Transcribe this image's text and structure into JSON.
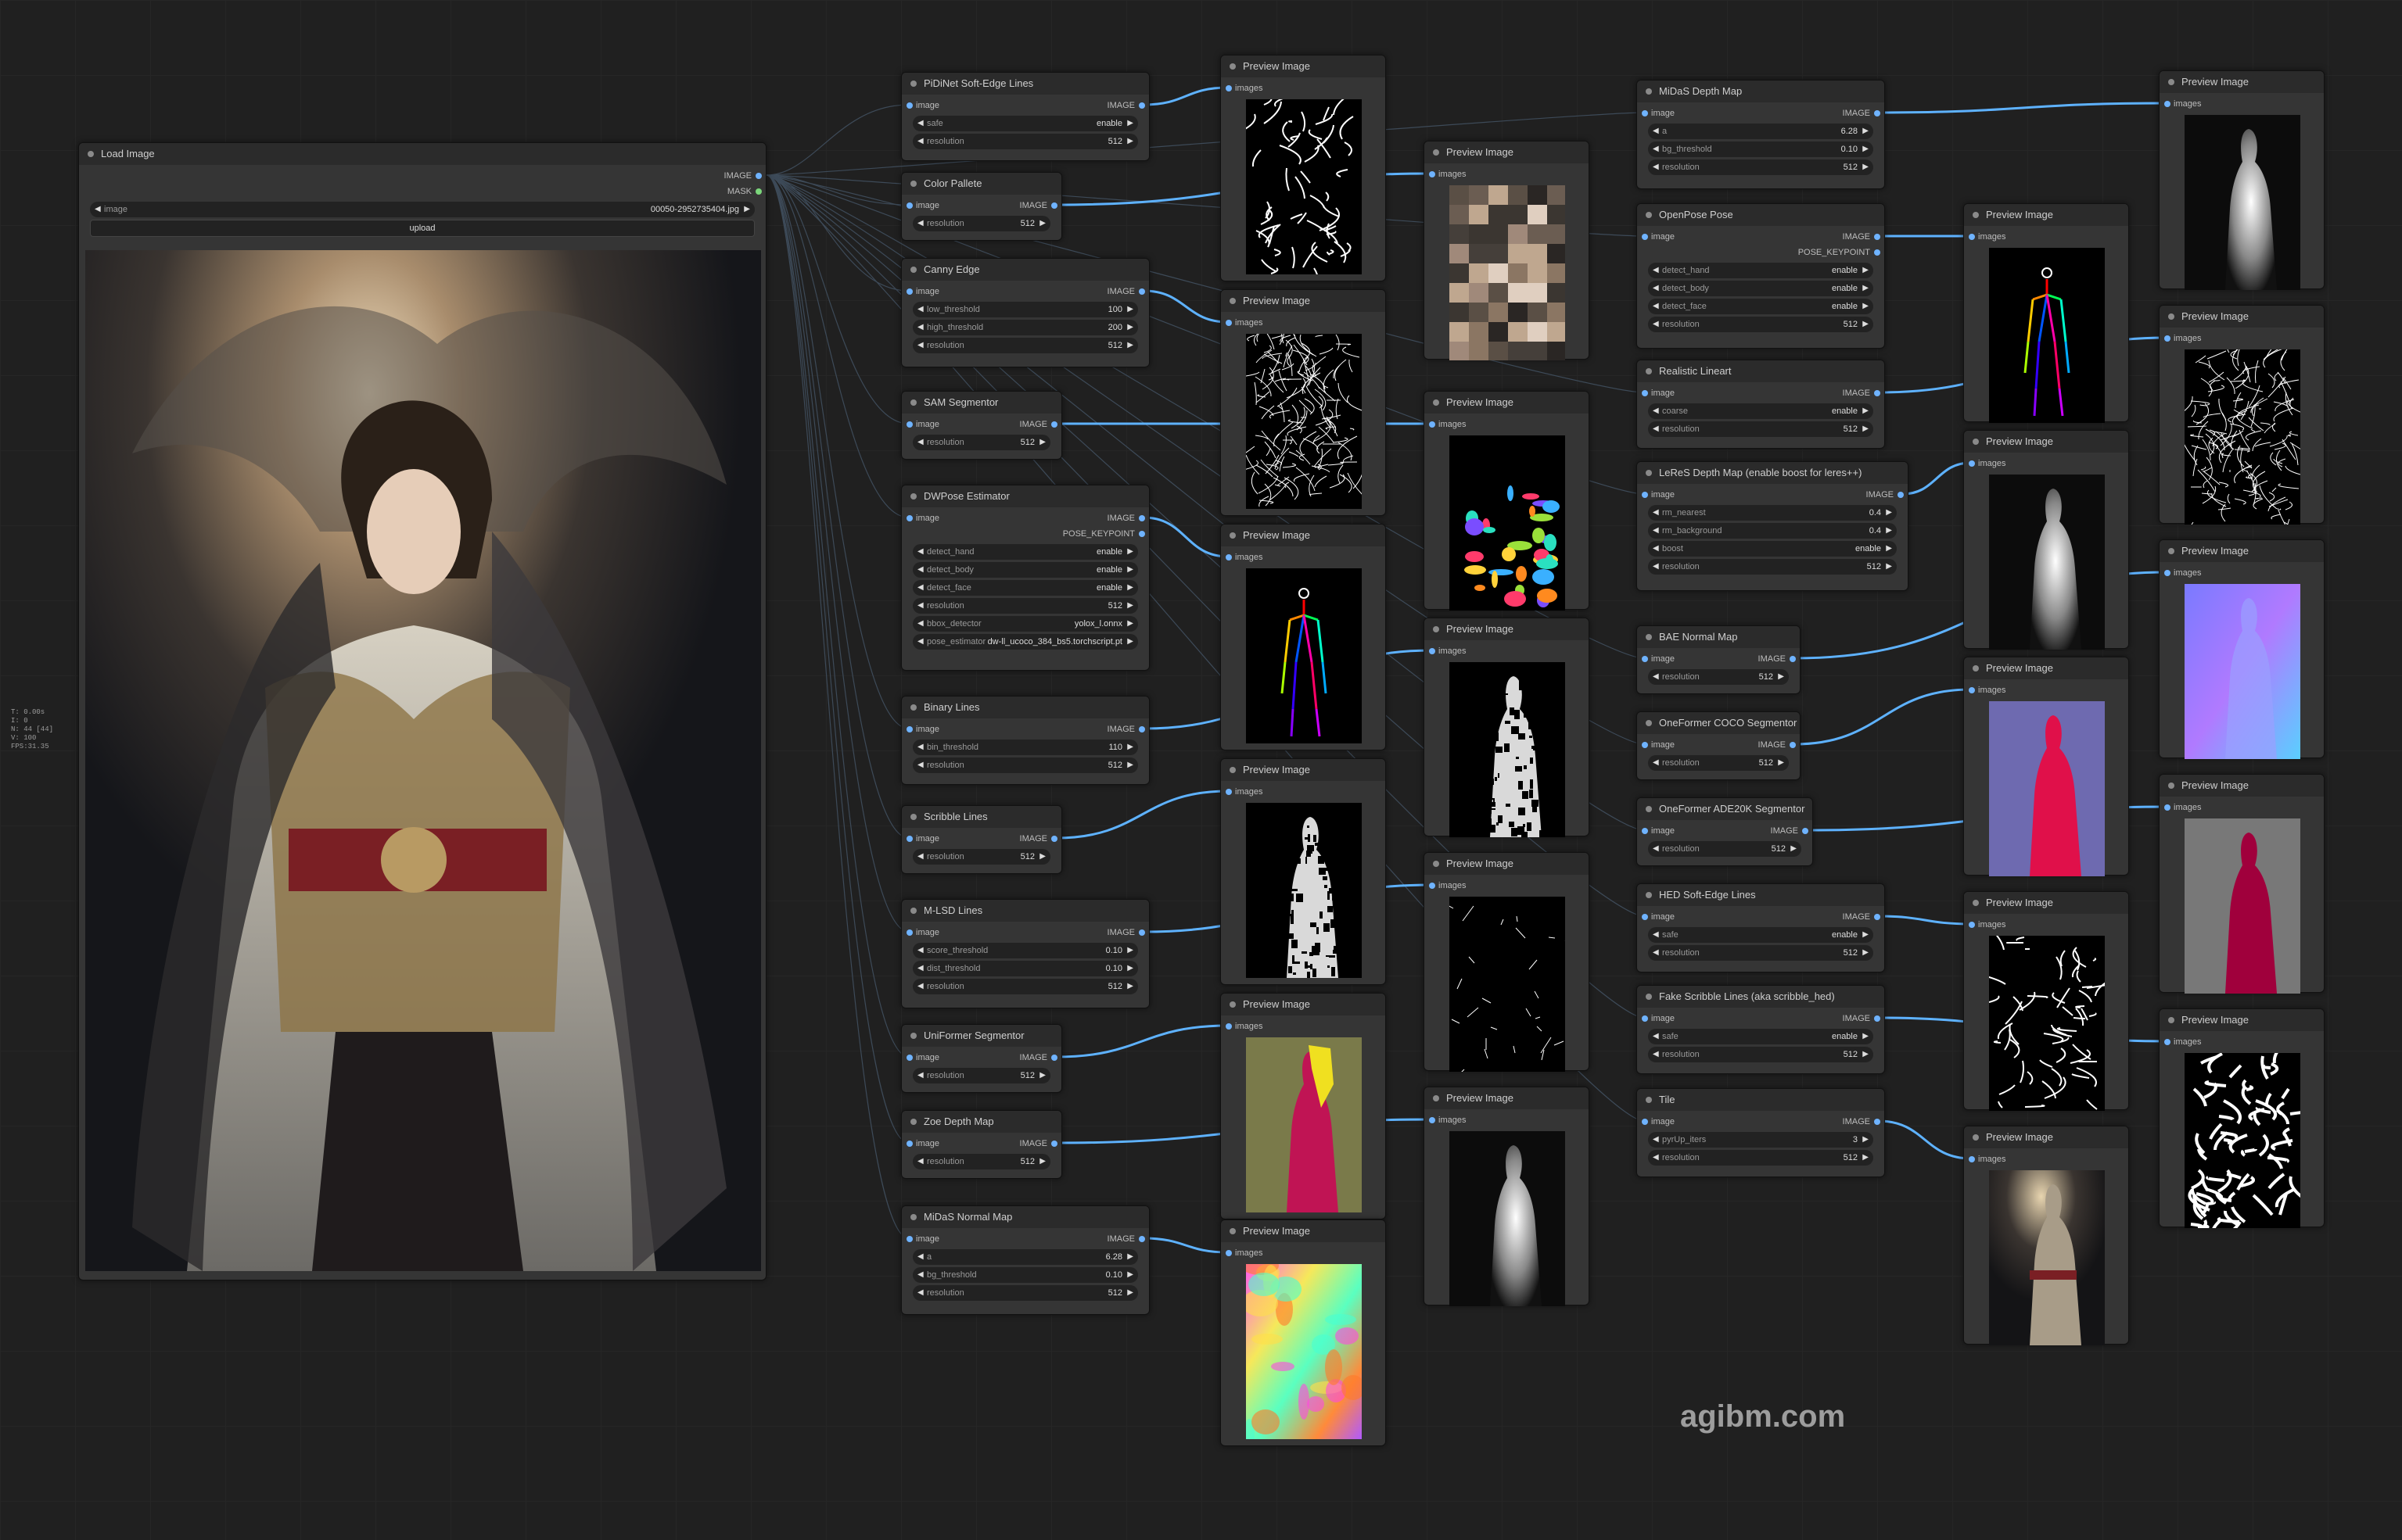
{
  "canvas_stats": [
    "T: 0.00s",
    "I: 0",
    "N: 44 [44]",
    "V: 100",
    "FPS:31.35"
  ],
  "watermark": "agibm.com",
  "load_image": {
    "title": "Load Image",
    "outputs": [
      "IMAGE",
      "MASK"
    ],
    "image_label": "image",
    "image_value": "00050-2952735404.jpg",
    "upload_label": "upload"
  },
  "preview_title": "Preview Image",
  "preview_input": "images",
  "colors": {
    "background": "#202020",
    "node": "#353535",
    "title_bar": "#2b2b2b",
    "link": "#5eb2ff",
    "slot_image": "#6fb3ff",
    "slot_mask": "#7bd67b"
  },
  "nodes": [
    {
      "title": "PiDiNet Soft-Edge Lines",
      "input": "image",
      "outputs": [
        "IMAGE"
      ],
      "widgets": [
        {
          "l": "safe",
          "v": "enable"
        },
        {
          "l": "resolution",
          "v": "512"
        }
      ]
    },
    {
      "title": "Color Pallete",
      "input": "image",
      "outputs": [
        "IMAGE"
      ],
      "widgets": [
        {
          "l": "resolution",
          "v": "512"
        }
      ]
    },
    {
      "title": "Canny Edge",
      "input": "image",
      "outputs": [
        "IMAGE"
      ],
      "widgets": [
        {
          "l": "low_threshold",
          "v": "100"
        },
        {
          "l": "high_threshold",
          "v": "200"
        },
        {
          "l": "resolution",
          "v": "512"
        }
      ]
    },
    {
      "title": "SAM Segmentor",
      "input": "image",
      "outputs": [
        "IMAGE"
      ],
      "widgets": [
        {
          "l": "resolution",
          "v": "512"
        }
      ]
    },
    {
      "title": "DWPose Estimator",
      "input": "image",
      "outputs": [
        "IMAGE",
        "POSE_KEYPOINT"
      ],
      "widgets": [
        {
          "l": "detect_hand",
          "v": "enable"
        },
        {
          "l": "detect_body",
          "v": "enable"
        },
        {
          "l": "detect_face",
          "v": "enable"
        },
        {
          "l": "resolution",
          "v": "512"
        },
        {
          "l": "bbox_detector",
          "v": "yolox_l.onnx"
        },
        {
          "l": "pose_estimator",
          "v": "dw-ll_ucoco_384_bs5.torchscript.pt"
        }
      ]
    },
    {
      "title": "Binary Lines",
      "input": "image",
      "outputs": [
        "IMAGE"
      ],
      "widgets": [
        {
          "l": "bin_threshold",
          "v": "110"
        },
        {
          "l": "resolution",
          "v": "512"
        }
      ]
    },
    {
      "title": "Scribble Lines",
      "input": "image",
      "outputs": [
        "IMAGE"
      ],
      "widgets": [
        {
          "l": "resolution",
          "v": "512"
        }
      ]
    },
    {
      "title": "M-LSD Lines",
      "input": "image",
      "outputs": [
        "IMAGE"
      ],
      "widgets": [
        {
          "l": "score_threshold",
          "v": "0.10"
        },
        {
          "l": "dist_threshold",
          "v": "0.10"
        },
        {
          "l": "resolution",
          "v": "512"
        }
      ]
    },
    {
      "title": "UniFormer Segmentor",
      "input": "image",
      "outputs": [
        "IMAGE"
      ],
      "widgets": [
        {
          "l": "resolution",
          "v": "512"
        }
      ]
    },
    {
      "title": "Zoe Depth Map",
      "input": "image",
      "outputs": [
        "IMAGE"
      ],
      "widgets": [
        {
          "l": "resolution",
          "v": "512"
        }
      ]
    },
    {
      "title": "MiDaS Normal Map",
      "input": "image",
      "outputs": [
        "IMAGE"
      ],
      "widgets": [
        {
          "l": "a",
          "v": "6.28"
        },
        {
          "l": "bg_threshold",
          "v": "0.10"
        },
        {
          "l": "resolution",
          "v": "512"
        }
      ]
    },
    {
      "title": "MiDaS Depth Map",
      "input": "image",
      "outputs": [
        "IMAGE"
      ],
      "widgets": [
        {
          "l": "a",
          "v": "6.28"
        },
        {
          "l": "bg_threshold",
          "v": "0.10"
        },
        {
          "l": "resolution",
          "v": "512"
        }
      ]
    },
    {
      "title": "OpenPose Pose",
      "input": "image",
      "outputs": [
        "IMAGE",
        "POSE_KEYPOINT"
      ],
      "widgets": [
        {
          "l": "detect_hand",
          "v": "enable"
        },
        {
          "l": "detect_body",
          "v": "enable"
        },
        {
          "l": "detect_face",
          "v": "enable"
        },
        {
          "l": "resolution",
          "v": "512"
        }
      ]
    },
    {
      "title": "Realistic Lineart",
      "input": "image",
      "outputs": [
        "IMAGE"
      ],
      "widgets": [
        {
          "l": "coarse",
          "v": "enable"
        },
        {
          "l": "resolution",
          "v": "512"
        }
      ]
    },
    {
      "title": "LeReS Depth Map (enable boost for leres++)",
      "input": "image",
      "outputs": [
        "IMAGE"
      ],
      "widgets": [
        {
          "l": "rm_nearest",
          "v": "0.4"
        },
        {
          "l": "rm_background",
          "v": "0.4"
        },
        {
          "l": "boost",
          "v": "enable"
        },
        {
          "l": "resolution",
          "v": "512"
        }
      ]
    },
    {
      "title": "BAE Normal Map",
      "input": "image",
      "outputs": [
        "IMAGE"
      ],
      "widgets": [
        {
          "l": "resolution",
          "v": "512"
        }
      ]
    },
    {
      "title": "OneFormer COCO Segmentor",
      "input": "image",
      "outputs": [
        "IMAGE"
      ],
      "widgets": [
        {
          "l": "resolution",
          "v": "512"
        }
      ]
    },
    {
      "title": "OneFormer ADE20K Segmentor",
      "input": "image",
      "outputs": [
        "IMAGE"
      ],
      "widgets": [
        {
          "l": "resolution",
          "v": "512"
        }
      ]
    },
    {
      "title": "HED Soft-Edge Lines",
      "input": "image",
      "outputs": [
        "IMAGE"
      ],
      "widgets": [
        {
          "l": "safe",
          "v": "enable"
        },
        {
          "l": "resolution",
          "v": "512"
        }
      ]
    },
    {
      "title": "Fake Scribble Lines (aka scribble_hed)",
      "input": "image",
      "outputs": [
        "IMAGE"
      ],
      "widgets": [
        {
          "l": "safe",
          "v": "enable"
        },
        {
          "l": "resolution",
          "v": "512"
        }
      ]
    },
    {
      "title": "Tile",
      "input": "image",
      "outputs": [
        "IMAGE"
      ],
      "widgets": [
        {
          "l": "pyrUp_iters",
          "v": "3"
        },
        {
          "l": "resolution",
          "v": "512"
        }
      ]
    }
  ],
  "previews": [
    {
      "kind": "lines-sparse"
    },
    {
      "kind": "pixel"
    },
    {
      "kind": "lines-dense"
    },
    {
      "kind": "sam"
    },
    {
      "kind": "pose"
    },
    {
      "kind": "binary"
    },
    {
      "kind": "binary"
    },
    {
      "kind": "mlsd"
    },
    {
      "kind": "uniformer"
    },
    {
      "kind": "depth"
    },
    {
      "kind": "normal-rainbow"
    },
    {
      "kind": "depth"
    },
    {
      "kind": "pose"
    },
    {
      "kind": "lines-dense"
    },
    {
      "kind": "depth"
    },
    {
      "kind": "normal-blue"
    },
    {
      "kind": "coco"
    },
    {
      "kind": "ade"
    },
    {
      "kind": "lines-sparse"
    },
    {
      "kind": "scribble"
    },
    {
      "kind": "photo"
    }
  ]
}
